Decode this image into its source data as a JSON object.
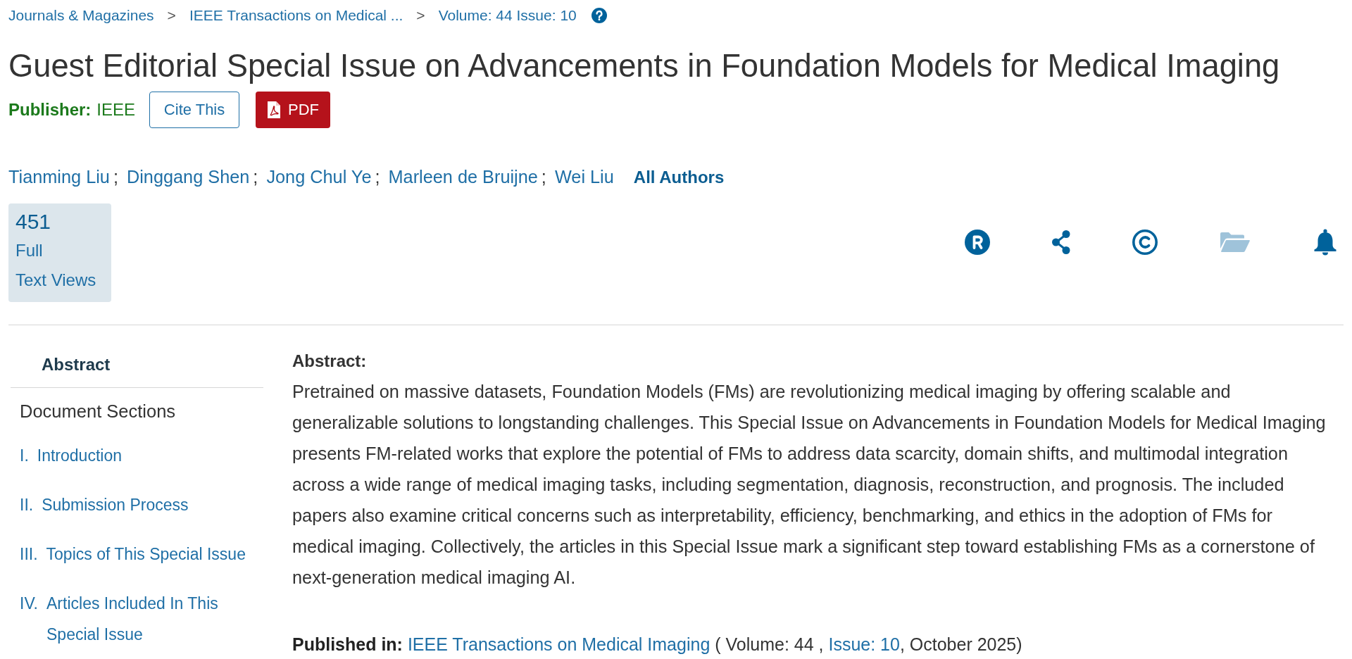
{
  "breadcrumb": [
    {
      "kind": "link",
      "text": "Journals & Magazines"
    },
    {
      "kind": "separator",
      "text": ">"
    },
    {
      "kind": "link",
      "text": "IEEE Transactions on Medical ..."
    },
    {
      "kind": "separator",
      "text": ">"
    },
    {
      "kind": "link",
      "text": "Volume: 44 Issue: 10"
    }
  ],
  "title": "Guest Editorial Special Issue on Advancements in Foundation Models for Medical Imaging",
  "publisher": {
    "label": "Publisher:",
    "name": "IEEE"
  },
  "actions": [
    {
      "kind": "cite",
      "label": "Cite This"
    },
    {
      "kind": "pdf",
      "label": "PDF"
    }
  ],
  "authors": [
    {
      "name": "Tianming Liu",
      "separator": ";"
    },
    {
      "name": "Dinggang Shen",
      "separator": ";"
    },
    {
      "name": "Jong Chul Ye",
      "separator": ";"
    },
    {
      "name": "Marleen de Bruijne",
      "separator": ";"
    },
    {
      "name": "Wei Liu"
    }
  ],
  "all_authors": "All Authors",
  "metrics": {
    "count": "451",
    "lines": [
      "Full",
      "Text Views"
    ]
  },
  "tools": [
    {
      "kind": "rights",
      "disabled": false
    },
    {
      "kind": "share",
      "disabled": false
    },
    {
      "kind": "copyright",
      "disabled": false
    },
    {
      "kind": "folder",
      "disabled": true
    },
    {
      "kind": "alerts",
      "disabled": false
    }
  ],
  "sidebar": {
    "tabs": [
      {
        "label": "Abstract",
        "selected": true
      }
    ],
    "sections_heading": "Document Sections",
    "sections": [
      {
        "number": "I.",
        "title": "Introduction"
      },
      {
        "number": "II.",
        "title": "Submission Process"
      },
      {
        "number": "III.",
        "title": "Topics of This Special Issue"
      },
      {
        "number": "IV.",
        "title": "Articles Included In This Special Issue"
      }
    ]
  },
  "abstract": {
    "heading": "Abstract:",
    "text": "Pretrained on massive datasets, Foundation Models (FMs) are revolutionizing medical imaging by offering scalable and generalizable solutions to longstanding challenges. This Special Issue on Advancements in Foundation Models for Medical Imaging presents FM-related works that explore the potential of FMs to address data scarcity, domain shifts, and multimodal integration across a wide range of medical imaging tasks, including segmentation, diagnosis, reconstruction, and prognosis. The included papers also examine critical concerns such as interpretability, efficiency, benchmarking, and ethics in the adoption of FMs for medical imaging. Collectively, the articles in this Special Issue mark a significant step toward establishing FMs as a cornerstone of next-generation medical imaging AI."
  },
  "published_in": {
    "label": "Published in:",
    "journal": "IEEE Transactions on Medical Imaging",
    "volume": "( Volume: 44 ,",
    "issue": "Issue: 10",
    "date": ", October 2025)"
  }
}
